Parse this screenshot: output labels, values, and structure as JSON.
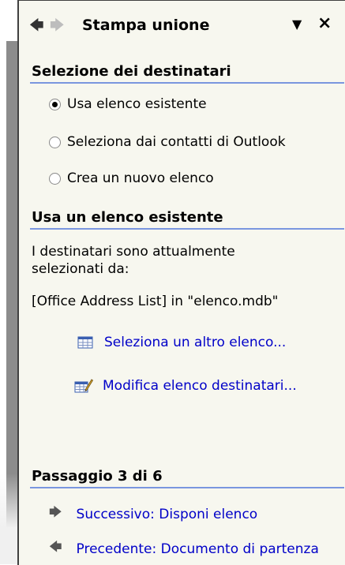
{
  "panel": {
    "title": "Stampa unione",
    "back_icon": "arrow-left-icon",
    "forward_icon": "arrow-right-icon",
    "menu_icon": "chevron-down-icon",
    "close_icon": "close-icon"
  },
  "recipients": {
    "heading": "Selezione dei destinatari",
    "options": [
      {
        "label": "Usa elenco esistente",
        "checked": true
      },
      {
        "label": "Seleziona dai contatti di Outlook",
        "checked": false
      },
      {
        "label": "Crea un nuovo elenco",
        "checked": false
      }
    ]
  },
  "existing_list": {
    "heading": "Usa un elenco esistente",
    "description": "I destinatari sono attualmente selezionati da:",
    "source": "[Office Address List] in \"elenco.mdb\"",
    "links": [
      {
        "label": "Seleziona un altro elenco...",
        "icon": "table-icon"
      },
      {
        "label": "Modifica elenco destinatari...",
        "icon": "edit-list-icon"
      }
    ]
  },
  "step": {
    "heading": "Passaggio 3 di 6",
    "next_label": "Successivo: Disponi elenco",
    "prev_label": "Precedente: Documento di partenza"
  },
  "colors": {
    "panel_bg": "#f7f7ef",
    "link": "#0000c8",
    "rule": "#7a96df"
  }
}
